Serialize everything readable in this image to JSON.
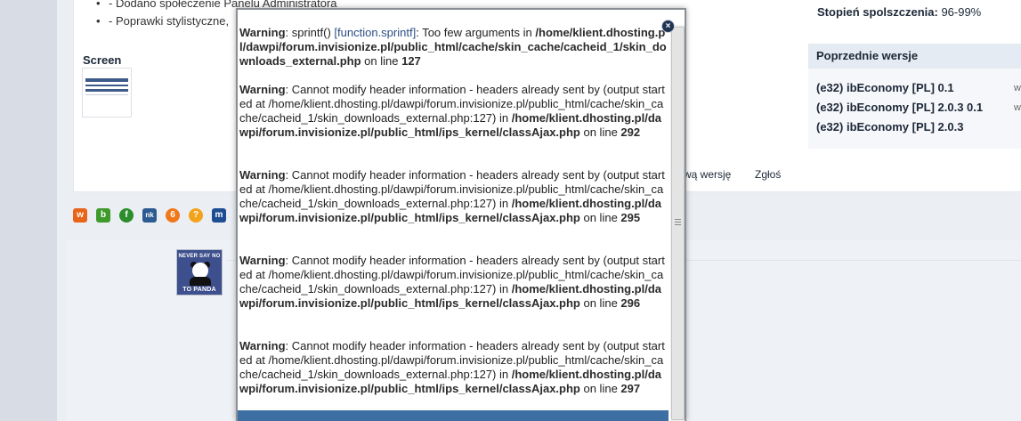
{
  "page": {
    "bullets": [
      "- Dodano społeczenie Panelu Administratora",
      "- Poprawki stylistyczne,"
    ],
    "screen_label": "Screen",
    "rating_label": "Stopień spolszczenia:",
    "rating_value": "96-99%",
    "prev_versions_title": "Poprzednie wersje",
    "prev_versions": [
      "(e32) ibEconomy [PL] 0.1",
      "(e32) ibEconomy [PL] 2.0.3 0.1",
      "(e32) ibEconomy [PL] 2.0.3"
    ],
    "prev_versions_side": [
      "w",
      "w"
    ],
    "action_new_version": "wą wersję",
    "action_report": "Zgłoś",
    "panda_top": "NEVER SAY NO",
    "panda_bottom": "TO PANDA"
  },
  "share_icons": [
    {
      "name": "wykop-icon",
      "color": "#e8641b",
      "glyph": "w"
    },
    {
      "name": "blip-icon",
      "color": "#3f9a2c",
      "glyph": "b"
    },
    {
      "name": "flaker-icon",
      "color": "#2c8d2c",
      "glyph": "f"
    },
    {
      "name": "nk-icon",
      "color": "#2c5b92",
      "glyph": "nk"
    },
    {
      "name": "gg-icon",
      "color": "#f0781b",
      "glyph": "6"
    },
    {
      "name": "sledzik-icon",
      "color": "#f2a21b",
      "glyph": "?"
    },
    {
      "name": "myspace-icon",
      "color": "#1d4e93",
      "glyph": "m"
    }
  ],
  "modal": {
    "close_label": "×",
    "warnings": [
      {
        "prefix": "Warning",
        "message": ": sprintf() ",
        "link": "[function.sprintf]",
        "message2": ": Too few arguments in",
        "path": "/home/klient.dhosting.pl/dawpi/forum.invisionize.pl/public_html/cache/skin_cache/cacheid_1/skin_downloads_external.php",
        "on_line": " on line ",
        "line": "127"
      },
      {
        "prefix": "Warning",
        "message": ": Cannot modify header information - headers already sent by (output started at /home/klient.dhosting.pl/dawpi/forum.invisionize.pl/public_html/cache/skin_cache/cacheid_1/skin_downloads_external.php:127) in",
        "path": "/home/klient.dhosting.pl/dawpi/forum.invisionize.pl/public_html/ips_kernel/classAjax.php",
        "on_line": " on line ",
        "line": "292"
      },
      {
        "prefix": "Warning",
        "message": ": Cannot modify header information - headers already sent by (output started at /home/klient.dhosting.pl/dawpi/forum.invisionize.pl/public_html/cache/skin_cache/cacheid_1/skin_downloads_external.php:127) in",
        "path": "/home/klient.dhosting.pl/dawpi/forum.invisionize.pl/public_html/ips_kernel/classAjax.php",
        "on_line": " on line ",
        "line": "295"
      },
      {
        "prefix": "Warning",
        "message": ": Cannot modify header information - headers already sent by (output started at /home/klient.dhosting.pl/dawpi/forum.invisionize.pl/public_html/cache/skin_cache/cacheid_1/skin_downloads_external.php:127) in",
        "path": "/home/klient.dhosting.pl/dawpi/forum.invisionize.pl/public_html/ips_kernel/classAjax.php",
        "on_line": " on line ",
        "line": "296"
      },
      {
        "prefix": "Warning",
        "message": ": Cannot modify header information - headers already sent by (output started at /home/klient.dhosting.pl/dawpi/forum.invisionize.pl/public_html/cache/skin_cache/cacheid_1/skin_downloads_external.php:127) in",
        "path": "/home/klient.dhosting.pl/dawpi/forum.invisionize.pl/public_html/ips_kernel/classAjax.php",
        "on_line": " on line ",
        "line": "297"
      }
    ]
  }
}
